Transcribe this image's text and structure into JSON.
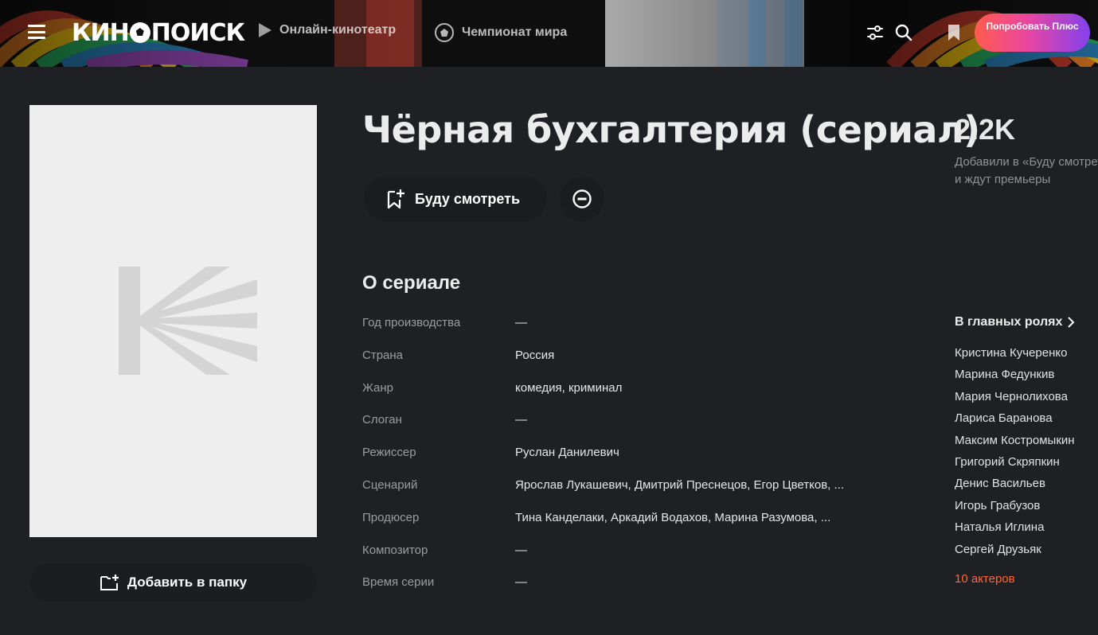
{
  "header": {
    "logo_text_left": "КИН",
    "logo_text_right": "ПОИСК",
    "nav_online": "Онлайн-кинотеатр",
    "nav_worldcup": "Чемпионат мира",
    "plus_button": "Попробовать Плюс",
    "banner_colors": [
      "#c0392b",
      "#e67e22",
      "#f1c40f",
      "#27ae60",
      "#2980b9",
      "#8e44ad"
    ]
  },
  "poster": {
    "add_to_folder": "Добавить в папку"
  },
  "main": {
    "title": "Чёрная бухгалтерия (сериал)",
    "watch_button": "Буду смотреть",
    "about_title": "О сериале",
    "info": [
      {
        "label": "Год производства",
        "value": "—"
      },
      {
        "label": "Страна",
        "value": "Россия"
      },
      {
        "label": "Жанр",
        "value": "комедия, криминал"
      },
      {
        "label": "Слоган",
        "value": "—"
      },
      {
        "label": "Режиссер",
        "value": "Руслан Данилевич"
      },
      {
        "label": "Сценарий",
        "value": "Ярослав Лукашевич, Дмитрий Преснецов, Егор Цветков, ..."
      },
      {
        "label": "Продюсер",
        "value": "Тина Канделаки, Аркадий Водахов, Марина Разумова, ..."
      },
      {
        "label": "Композитор",
        "value": "—"
      },
      {
        "label": "Время серии",
        "value": "—"
      }
    ]
  },
  "aside": {
    "rating": "2.2K",
    "rating_desc_line1": "Добавили в «Буду смотреть»",
    "rating_desc_line2": "и ждут премьеры",
    "cast_title": "В главных ролях",
    "cast": [
      "Кристина Кучеренко",
      "Марина Федункив",
      "Мария Чернолихова",
      "Лариса Баранова",
      "Максим Костромыкин",
      "Григорий Скряпкин",
      "Денис Васильев",
      "Игорь Грабузов",
      "Наталья Иглина",
      "Сергей Друзьяк"
    ],
    "cast_more": "10 актеров",
    "accent_color": "#ff6633"
  }
}
